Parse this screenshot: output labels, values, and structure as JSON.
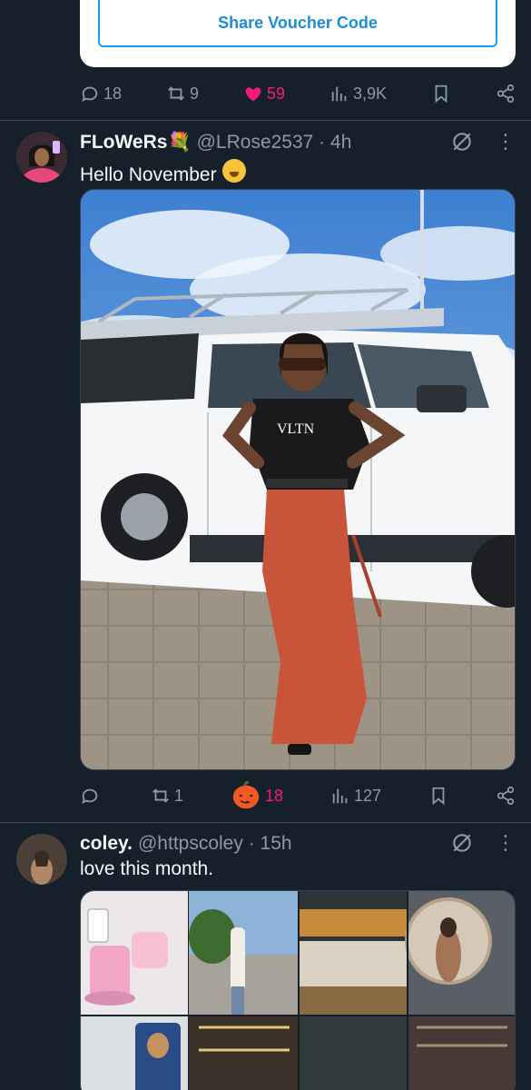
{
  "previous_tweet": {
    "voucher_button": "Share Voucher Code",
    "actions": {
      "replies": "18",
      "reposts": "9",
      "likes": "59",
      "views": "3,9K"
    }
  },
  "tweets": [
    {
      "name": "FLoWeRs💐",
      "handle": "@LRose2537 · 4h",
      "text": "Hello November",
      "actions": {
        "replies": "",
        "reposts": "1",
        "likes": "18",
        "views": "127"
      }
    },
    {
      "name": "coley.",
      "handle": "@httpscoley · 15h",
      "text": "love this month."
    }
  ],
  "colors": {
    "background": "#15202b",
    "muted": "#8b98a5",
    "like": "#f91880",
    "accent": "#1d9bf0"
  }
}
